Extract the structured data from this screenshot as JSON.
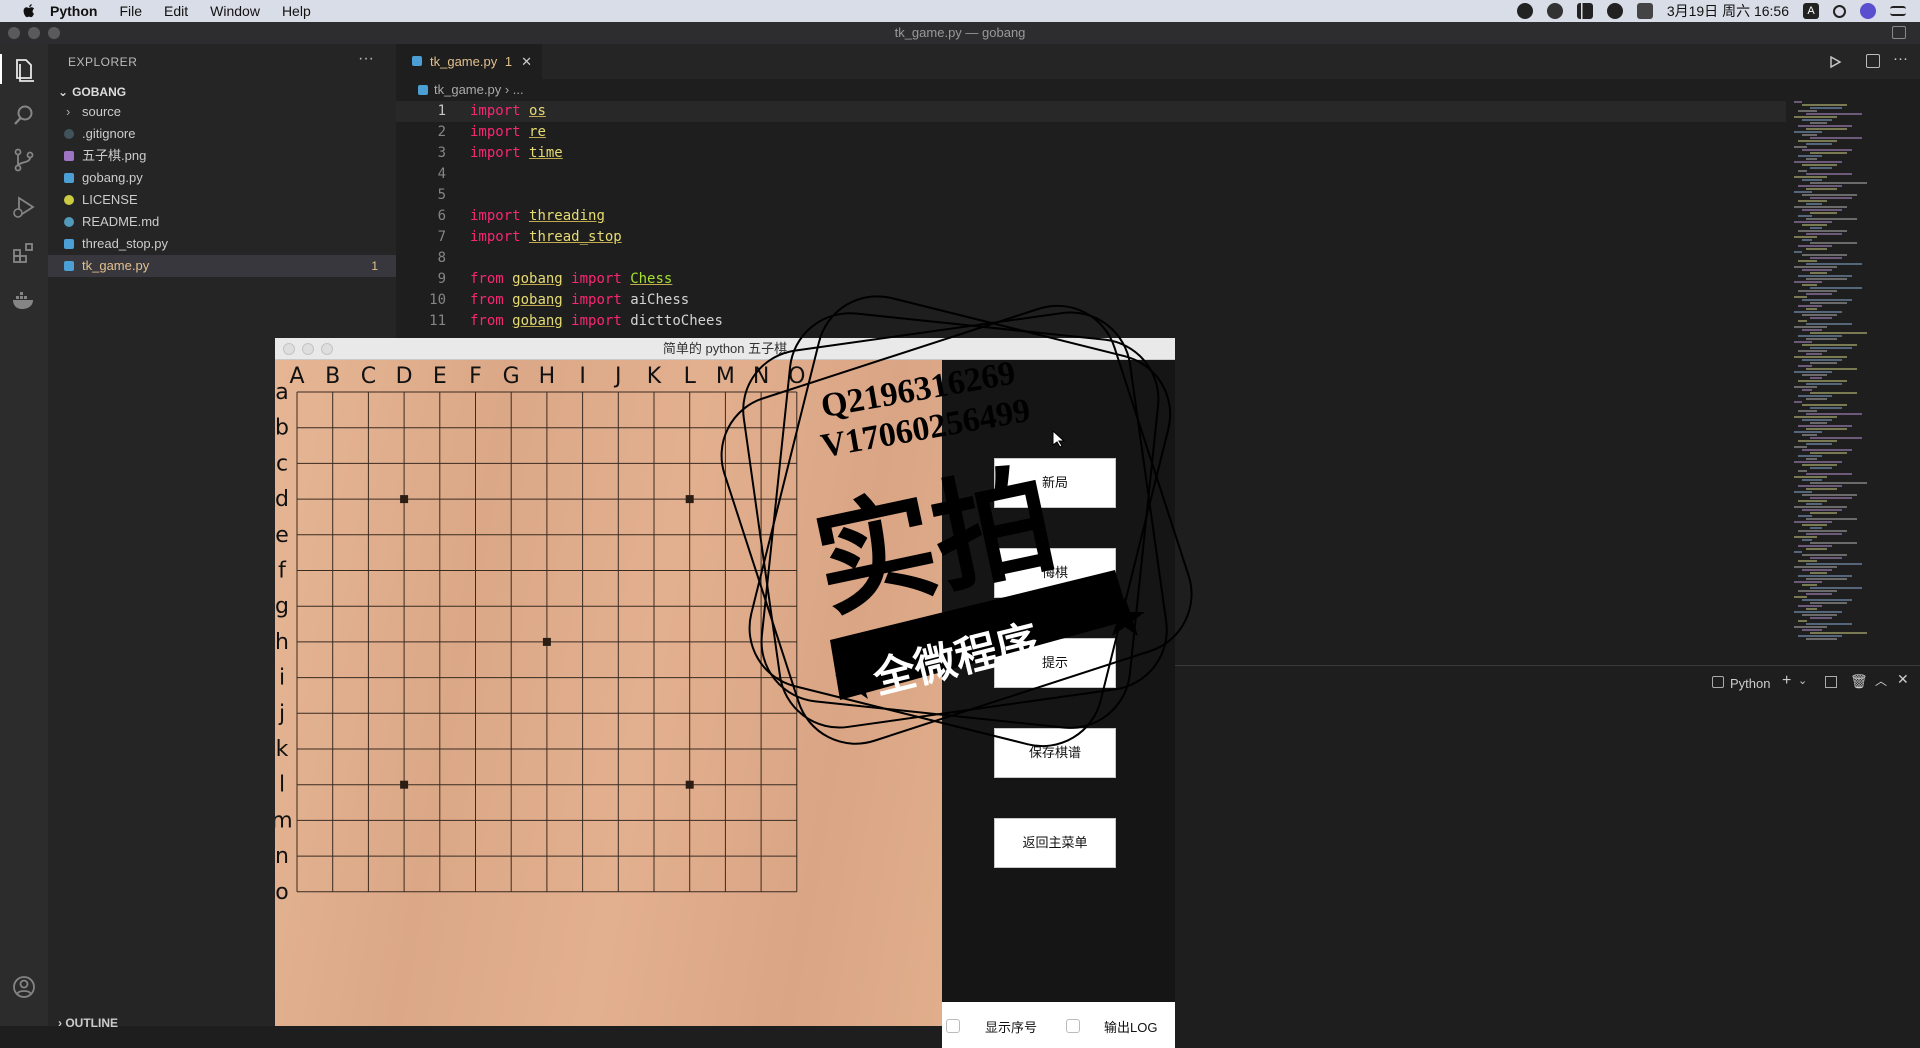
{
  "menubar": {
    "app": "Python",
    "items": [
      "File",
      "Edit",
      "Window",
      "Help"
    ],
    "clock": "3月19日 周六  16:56",
    "input_method": "A"
  },
  "window_title": "tk_game.py — gobang",
  "explorer": {
    "header": "EXPLORER",
    "folder": "GOBANG",
    "files": [
      {
        "name": "source",
        "icon": "folder-icon"
      },
      {
        "name": ".gitignore",
        "icon": "gitignore-icon"
      },
      {
        "name": "五子棋.png",
        "icon": "image-icon"
      },
      {
        "name": "gobang.py",
        "icon": "python-icon"
      },
      {
        "name": "LICENSE",
        "icon": "license-icon"
      },
      {
        "name": "README.md",
        "icon": "info-icon"
      },
      {
        "name": "thread_stop.py",
        "icon": "python-icon"
      },
      {
        "name": "tk_game.py",
        "icon": "python-icon",
        "badge": "1"
      }
    ],
    "outline": "OUTLINE"
  },
  "editor": {
    "tab": "tk_game.py",
    "tab_badge": "1",
    "breadcrumb_file": "tk_game.py",
    "breadcrumb_rest": "...",
    "lines": [
      {
        "n": "1",
        "parts": [
          [
            "kw",
            "import"
          ],
          [
            "sp",
            " "
          ],
          [
            "mod",
            "os"
          ]
        ]
      },
      {
        "n": "2",
        "parts": [
          [
            "kw",
            "import"
          ],
          [
            "sp",
            " "
          ],
          [
            "mod",
            "re"
          ]
        ]
      },
      {
        "n": "3",
        "parts": [
          [
            "kw",
            "import"
          ],
          [
            "sp",
            " "
          ],
          [
            "mod",
            "time"
          ]
        ]
      },
      {
        "n": "4",
        "parts": []
      },
      {
        "n": "5",
        "parts": []
      },
      {
        "n": "6",
        "parts": [
          [
            "kw",
            "import"
          ],
          [
            "sp",
            " "
          ],
          [
            "mod",
            "threading"
          ]
        ]
      },
      {
        "n": "7",
        "parts": [
          [
            "kw",
            "import"
          ],
          [
            "sp",
            " "
          ],
          [
            "mod",
            "thread_stop"
          ]
        ]
      },
      {
        "n": "8",
        "parts": []
      },
      {
        "n": "9",
        "parts": [
          [
            "kw",
            "from"
          ],
          [
            "sp",
            " "
          ],
          [
            "mod",
            "gobang"
          ],
          [
            "sp",
            " "
          ],
          [
            "kw",
            "import"
          ],
          [
            "sp",
            " "
          ],
          [
            "cls",
            "Chess"
          ]
        ]
      },
      {
        "n": "10",
        "parts": [
          [
            "kw",
            "from"
          ],
          [
            "sp",
            " "
          ],
          [
            "mod",
            "gobang"
          ],
          [
            "sp",
            " "
          ],
          [
            "kw",
            "import"
          ],
          [
            "sp",
            " "
          ],
          [
            "pl",
            "aiChess"
          ]
        ]
      },
      {
        "n": "11",
        "parts": [
          [
            "kw",
            "from"
          ],
          [
            "sp",
            " "
          ],
          [
            "mod",
            "gobang"
          ],
          [
            "sp",
            " "
          ],
          [
            "kw",
            "import"
          ],
          [
            "sp",
            " "
          ],
          [
            "pl",
            "dicttoChees"
          ]
        ]
      }
    ]
  },
  "panel": {
    "terminal_label": "Python"
  },
  "tk_window": {
    "title": "简单的 python 五子棋",
    "columns": [
      "A",
      "B",
      "C",
      "D",
      "E",
      "F",
      "G",
      "H",
      "I",
      "J",
      "K",
      "L",
      "M",
      "N",
      "O"
    ],
    "rows": [
      "a",
      "b",
      "c",
      "d",
      "e",
      "f",
      "g",
      "h",
      "i",
      "j",
      "k",
      "l",
      "m",
      "n",
      "o"
    ],
    "buttons": [
      "新局",
      "悔棋",
      "提示",
      "保存棋谱",
      "返回主菜单"
    ],
    "checkbox_show_index": "显示序号",
    "checkbox_log": "输出LOG"
  },
  "watermark": {
    "line1": "Q2196316269",
    "line2": "V17060256499",
    "big": "实拍",
    "banner": "全微程序"
  }
}
